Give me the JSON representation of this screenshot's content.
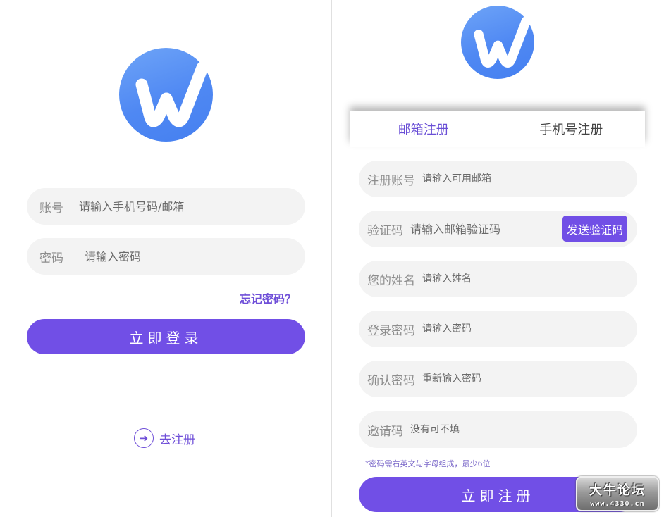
{
  "colors": {
    "accent": "#714fe6",
    "field_bg": "#f3f3f3",
    "logo": "#4f88f3"
  },
  "login": {
    "logo_icon": "w-logo-icon",
    "account_label": "账号",
    "account_placeholder": "请输入手机号码/邮箱",
    "password_label": "密码",
    "password_placeholder": "请输入密码",
    "forgot_label": "忘记密码？",
    "login_button": "立即登录",
    "register_icon": "arrow-right-circle-icon",
    "register_link": "去注册"
  },
  "register": {
    "logo_icon": "w-logo-icon",
    "tabs": [
      {
        "label": "邮箱注册",
        "active": true
      },
      {
        "label": "手机号注册",
        "active": false
      }
    ],
    "fields": [
      {
        "label": "注册账号",
        "placeholder": "请输入可用邮箱"
      },
      {
        "label": "验证码",
        "placeholder": "请输入邮箱验证码"
      },
      {
        "label": "您的姓名",
        "placeholder": "请输入姓名"
      },
      {
        "label": "登录密码",
        "placeholder": "请输入密码"
      },
      {
        "label": "确认密码",
        "placeholder": "重新输入密码"
      },
      {
        "label": "邀请码",
        "placeholder": "没有可不填"
      }
    ],
    "send_code_button": "发送验证码",
    "hint": "*密码需右英文与字母组成，最少6位",
    "register_button": "立即注册"
  },
  "watermark": {
    "line1": "大牛论坛",
    "line2": "www.4330.cn"
  }
}
